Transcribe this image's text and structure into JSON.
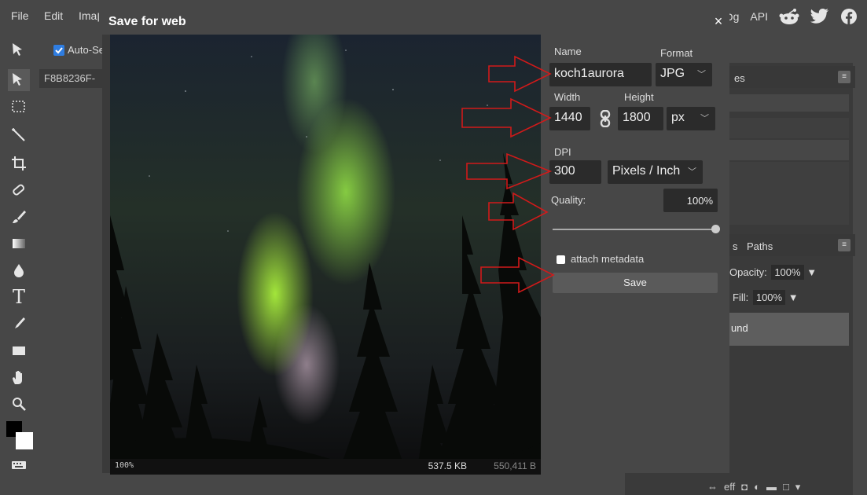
{
  "menu": {
    "file": "File",
    "edit": "Edit",
    "image_partial": "Imaן",
    "right_partial": "כg",
    "api": "API"
  },
  "options_bar": {
    "auto_select": "Auto-Sel",
    "document_tab": "F8B8236F-"
  },
  "dialog": {
    "title": "Save for web",
    "close_glyph": "×",
    "preview": {
      "zoom": "100%",
      "size_kb": "537.5 KB",
      "size_bytes": "550,411 B"
    },
    "form": {
      "name_label": "Name",
      "name_value": "koch1aurora",
      "format_label": "Format",
      "format_value": "JPG",
      "width_label": "Width",
      "width_value": "1440",
      "height_label": "Height",
      "height_value": "1800",
      "unit_value": "px",
      "dpi_label": "DPI",
      "dpi_value": "300",
      "dpi_unit_value": "Pixels / Inch",
      "quality_label": "Quality:",
      "quality_value": "100%",
      "quality_level": 1.0,
      "metadata_label": "attach metadata",
      "metadata_checked": false,
      "save_label": "Save"
    }
  },
  "right_panel": {
    "tab_partial_s": "s",
    "paths_tab": "Paths",
    "opacity_label": "Opacity:",
    "opacity_value": "100%",
    "fill_label": "Fill:",
    "fill_value": "100%",
    "layer_partial": "und",
    "panel_partial_es": "es",
    "bottom_eff": "eff"
  },
  "colors": {
    "arrow": "#d11a1a",
    "dialog_bg": "#474747",
    "field_bg": "#2b2b2b"
  }
}
